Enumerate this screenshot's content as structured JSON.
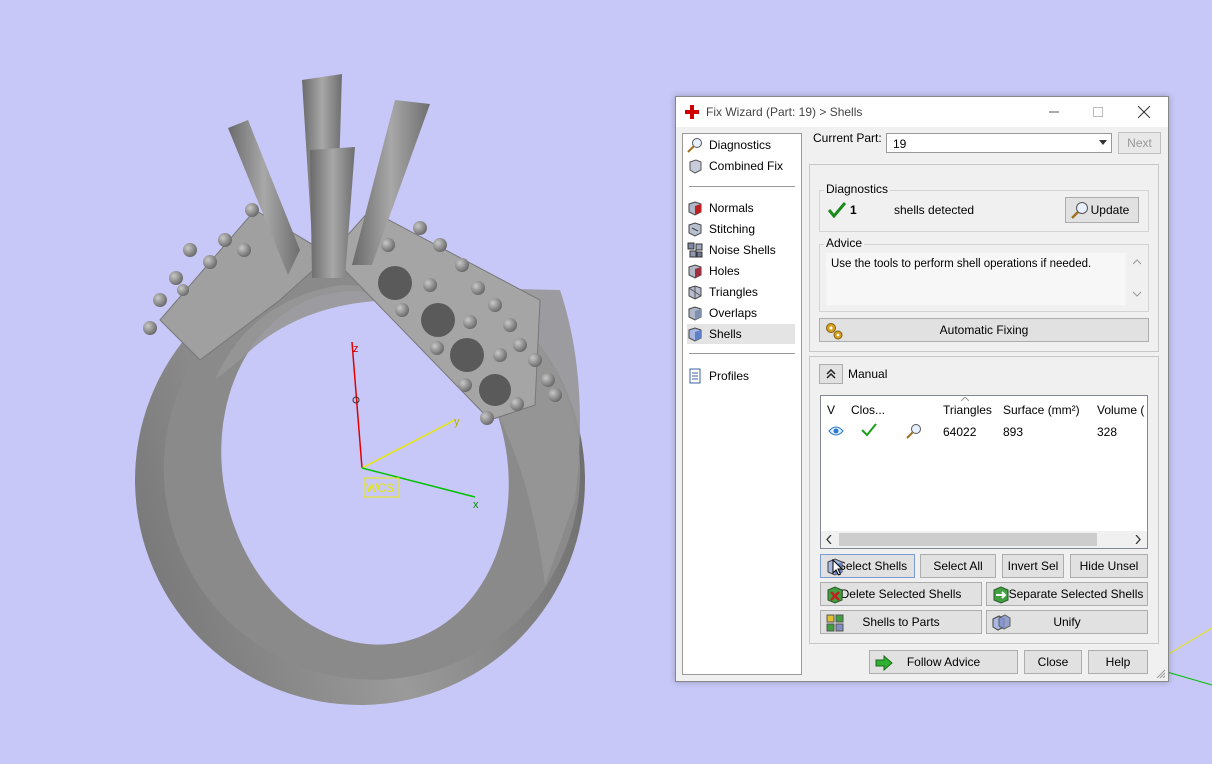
{
  "viewport": {
    "axis_z": "z",
    "axis_y": "y",
    "axis_x": "x",
    "wcs_label": "WCS",
    "background": "#c8c8f8"
  },
  "dialog": {
    "title": "Fix Wizard (Part: 19) > Shells",
    "nav": {
      "top_items": [
        {
          "label": "Diagnostics",
          "icon": "magnifier-icon"
        },
        {
          "label": "Combined Fix",
          "icon": "cube-icon"
        }
      ],
      "fix_items": [
        {
          "label": "Normals",
          "icon": "normals-cube-icon"
        },
        {
          "label": "Stitching",
          "icon": "stitching-cube-icon"
        },
        {
          "label": "Noise Shells",
          "icon": "noise-shells-icon"
        },
        {
          "label": "Holes",
          "icon": "holes-cube-icon"
        },
        {
          "label": "Triangles",
          "icon": "triangles-icon"
        },
        {
          "label": "Overlaps",
          "icon": "overlaps-cube-icon"
        },
        {
          "label": "Shells",
          "icon": "shells-cube-icon",
          "selected": true
        }
      ],
      "bottom_items": [
        {
          "label": "Profiles",
          "icon": "document-icon"
        }
      ]
    },
    "current_part_label": "Current Part:",
    "current_part_value": "19",
    "next_button": "Next",
    "diagnostics": {
      "title": "Diagnostics",
      "count": "1",
      "status_text": "shells detected",
      "update_button": "Update"
    },
    "advice": {
      "title": "Advice",
      "text": "Use the tools to perform shell operations if needed."
    },
    "automatic_fixing_button": "Automatic Fixing",
    "manual_label": "Manual",
    "table": {
      "columns": [
        "V",
        "Clos...",
        "",
        "Triangles",
        "Surface (mm²)",
        "Volume ("
      ],
      "rows": [
        {
          "visible_icon": "eye-icon",
          "closed_icon": "checkmark-icon",
          "action_icon": "magnifier-icon",
          "triangles": "64022",
          "surface": "893",
          "volume": "328"
        }
      ]
    },
    "buttons": {
      "select_shells": "Select Shells",
      "select_all": "Select All",
      "invert_sel": "Invert Sel",
      "hide_unsel": "Hide Unsel",
      "delete_selected_shells": "Delete Selected Shells",
      "separate_selected_shells": "Separate Selected Shells",
      "shells_to_parts": "Shells to Parts",
      "unify": "Unify",
      "follow_advice": "Follow Advice",
      "close": "Close",
      "help": "Help"
    }
  }
}
